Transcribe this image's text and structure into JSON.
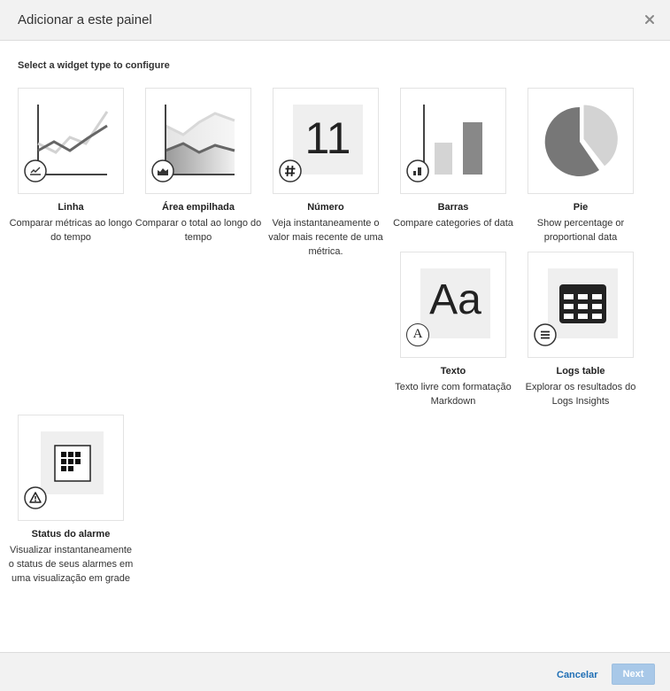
{
  "modal": {
    "title": "Adicionar a este painel",
    "subtitle": "Select a widget type to configure"
  },
  "widgets": [
    {
      "title": "Linha",
      "description": "Comparar métricas ao longo do tempo",
      "icon": "line-chart-icon"
    },
    {
      "title": "Área empilhada",
      "description": "Comparar o total ao longo do tempo",
      "icon": "stacked-area-icon"
    },
    {
      "title": "Número",
      "description": "Veja instantaneamente o valor mais recente de uma métrica.",
      "icon": "hash-icon",
      "preview_value": "11"
    },
    {
      "title": "Barras",
      "description": "Compare categories of data",
      "icon": "bar-chart-icon"
    },
    {
      "title": "Pie",
      "description": "Show percentage or proportional data",
      "icon": "pie-chart-icon"
    },
    {
      "title": "Texto",
      "description": "Texto livre com formatação Markdown",
      "icon": "text-icon",
      "preview_value": "Aa",
      "badge_letter": "A"
    },
    {
      "title": "Logs table",
      "description": "Explorar os resultados do Logs Insights",
      "icon": "list-icon"
    },
    {
      "title": "Status do alarme",
      "description": "Visualizar instantaneamente o status de seus alarmes em uma visualização em grade",
      "icon": "alarm-warning-icon"
    }
  ],
  "footer": {
    "cancel_label": "Cancelar",
    "next_label": "Next"
  },
  "colors": {
    "header_bg": "#f2f2f2",
    "link": "#1f6fb5",
    "next_disabled": "#a8c8e8",
    "chart_dark": "#555555",
    "chart_light": "#cccccc"
  }
}
